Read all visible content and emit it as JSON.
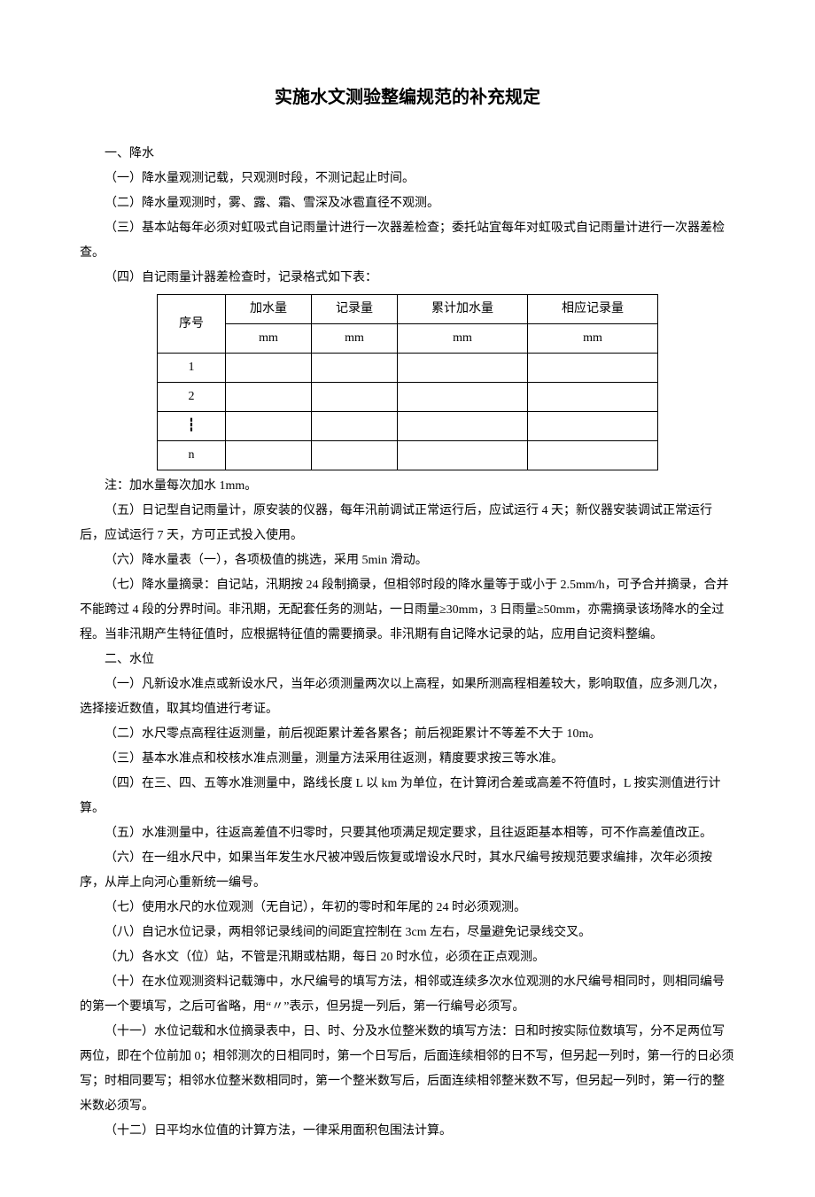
{
  "title": "实施水文测验整编规范的补充规定",
  "s1": {
    "heading": "一、降水",
    "p1": "（一）降水量观测记载，只观测时段，不测记起止时间。",
    "p2": "（二）降水量观测时，雾、露、霜、雪深及冰雹直径不观测。",
    "p3": "（三）基本站每年必须对虹吸式自记雨量计进行一次器差检查；委托站宜每年对虹吸式自记雨量计进行一次器差检查。",
    "p4": "（四）自记雨量计器差检查时，记录格式如下表：",
    "table": {
      "h_seq": "序号",
      "h_a": "加水量",
      "h_b": "记录量",
      "h_c": "累计加水量",
      "h_d": "相应记录量",
      "unit": "mm",
      "r1": "1",
      "r2": "2",
      "r3": "┇",
      "r4": "n"
    },
    "note": "注：加水量每次加水 1mm。",
    "p5": "（五）日记型自记雨量计，原安装的仪器，每年汛前调试正常运行后，应试运行 4 天；新仪器安装调试正常运行后，应试运行 7 天，方可正式投入使用。",
    "p6": "（六）降水量表（一），各项极值的挑选，采用 5min 滑动。",
    "p7": "（七）降水量摘录：自记站，汛期按 24 段制摘录，但相邻时段的降水量等于或小于 2.5mm/h，可予合并摘录，合并不能跨过 4 段的分界时间。非汛期，无配套任务的测站，一日雨量≥30mm，3 日雨量≥50mm，亦需摘录该场降水的全过程。当非汛期产生特征值时，应根据特征值的需要摘录。非汛期有自记降水记录的站，应用自记资料整编。"
  },
  "s2": {
    "heading": "二、水位",
    "p1": "（一）凡新设水准点或新设水尺，当年必须测量两次以上高程，如果所测高程相差较大，影响取值，应多测几次，选择接近数值，取其均值进行考证。",
    "p2": "（二）水尺零点高程往返测量，前后视距累计差各累各；前后视距累计不等差不大于 10m。",
    "p3": "（三）基本水准点和校核水准点测量，测量方法采用往返测，精度要求按三等水准。",
    "p4": "（四）在三、四、五等水准测量中，路线长度 L 以 km 为单位，在计算闭合差或高差不符值时，L 按实测值进行计算。",
    "p5": "（五）水准测量中，往返高差值不归零时，只要其他项满足规定要求，且往返距基本相等，可不作高差值改正。",
    "p6": "（六）在一组水尺中，如果当年发生水尺被冲毁后恢复或增设水尺时，其水尺编号按规范要求编排，次年必须按序，从岸上向河心重新统一编号。",
    "p7": "（七）使用水尺的水位观测（无自记），年初的零时和年尾的 24 时必须观测。",
    "p8": "（八）自记水位记录，两相邻记录线间的间距宜控制在 3cm 左右，尽量避免记录线交叉。",
    "p9": "（九）各水文（位）站，不管是汛期或枯期，每日 20 时水位，必须在正点观测。",
    "p10": "（十）在水位观测资料记载簿中，水尺编号的填写方法，相邻或连续多次水位观测的水尺编号相同时，则相同编号的第一个要填写，之后可省略，用“〃”表示，但另提一列后，第一行编号必须写。",
    "p11": "（十一）水位记载和水位摘录表中，日、时、分及水位整米数的填写方法：日和时按实际位数填写，分不足两位写两位，即在个位前加 0；相邻测次的日相同时，第一个日写后，后面连续相邻的日不写，但另起一列时，第一行的日必须写；时相同要写；相邻水位整米数相同时，第一个整米数写后，后面连续相邻整米数不写，但另起一列时，第一行的整米数必须写。",
    "p12": "（十二）日平均水位值的计算方法，一律采用面积包围法计算。"
  }
}
